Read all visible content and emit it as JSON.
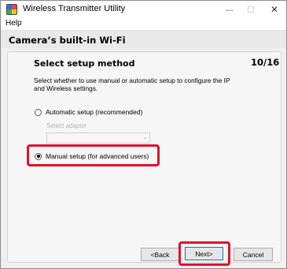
{
  "window": {
    "title": "Wireless Transmitter Utility",
    "controls": {
      "minimize": "—",
      "maximize": "☐",
      "close": "✕"
    }
  },
  "menu": {
    "help": "Help"
  },
  "header": {
    "title": "Camera’s built-in Wi-Fi"
  },
  "step": {
    "title": "Select setup method",
    "counter": "10/16",
    "description": "Select whether to use manual or automatic setup to configure the IP and Wireless settings."
  },
  "options": {
    "automatic": {
      "label": "Automatic setup (recommended)",
      "selected": false
    },
    "adapter_label": "Select adapter",
    "adapter_value": "",
    "manual": {
      "label": "Manual setup (for advanced users)",
      "selected": true
    }
  },
  "buttons": {
    "back": "<Back",
    "next": "Next>",
    "cancel": "Cancel"
  },
  "colors": {
    "highlight": "#e4102c",
    "focus": "#0078d7"
  },
  "icons": {
    "app": "app-icon",
    "dropdown": "chevron-down-icon"
  }
}
